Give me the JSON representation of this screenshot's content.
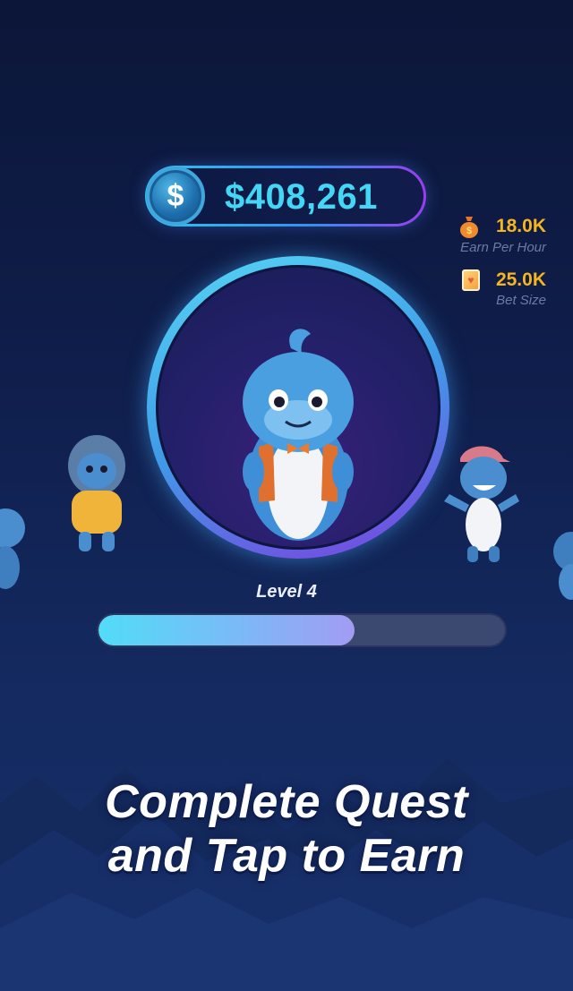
{
  "balance": {
    "currency_symbol": "$",
    "amount": "$408,261"
  },
  "stats": [
    {
      "value": "18.0K",
      "label": "Earn Per Hour",
      "icon": "money-bag-icon"
    },
    {
      "value": "25.0K",
      "label": "Bet Size",
      "icon": "playing-card-icon"
    }
  ],
  "level": {
    "label": "Level 4",
    "progress": 0.63
  },
  "headline": {
    "line1": "Complete Quest",
    "line2": "and Tap to Earn"
  },
  "colors": {
    "accent_cyan": "#43d7f5",
    "stat_gold": "#f5b51e",
    "background": "#0f1d4a"
  }
}
